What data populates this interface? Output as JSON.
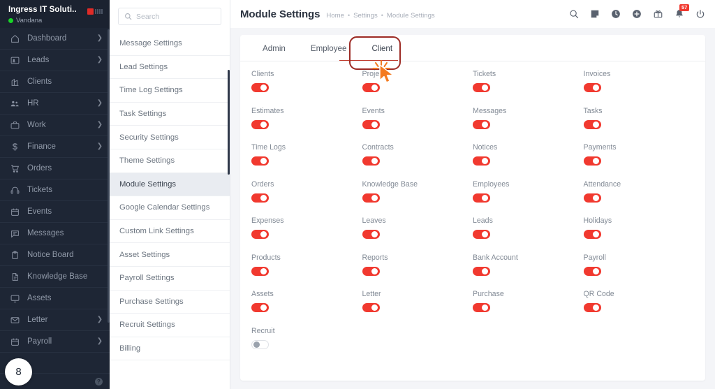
{
  "sidebar": {
    "org_name": "Ingress IT Soluti...",
    "user_name": "Vandana",
    "status_dot_color": "#18d427",
    "logo_color": "#e02b27",
    "items": [
      {
        "label": "Dashboard",
        "icon": "home-icon",
        "has_chevron": true
      },
      {
        "label": "Leads",
        "icon": "leads-icon",
        "has_chevron": true
      },
      {
        "label": "Clients",
        "icon": "clients-icon",
        "has_chevron": false
      },
      {
        "label": "HR",
        "icon": "hr-icon",
        "has_chevron": true
      },
      {
        "label": "Work",
        "icon": "work-icon",
        "has_chevron": true
      },
      {
        "label": "Finance",
        "icon": "finance-icon",
        "has_chevron": true
      },
      {
        "label": "Orders",
        "icon": "orders-icon",
        "has_chevron": false
      },
      {
        "label": "Tickets",
        "icon": "tickets-icon",
        "has_chevron": false
      },
      {
        "label": "Events",
        "icon": "events-icon",
        "has_chevron": false
      },
      {
        "label": "Messages",
        "icon": "messages-icon",
        "has_chevron": false
      },
      {
        "label": "Notice Board",
        "icon": "notice-board-icon",
        "has_chevron": false
      },
      {
        "label": "Knowledge Base",
        "icon": "knowledge-base-icon",
        "has_chevron": false
      },
      {
        "label": "Assets",
        "icon": "assets-icon",
        "has_chevron": false
      },
      {
        "label": "Letter",
        "icon": "letter-icon",
        "has_chevron": true
      },
      {
        "label": "Payroll",
        "icon": "payroll-icon",
        "has_chevron": true
      }
    ],
    "step_badge": "8",
    "help_glyph": "?"
  },
  "settings_panel": {
    "search_placeholder": "Search",
    "search_value": "",
    "active_item": "Module Settings",
    "items": [
      "Message Settings",
      "Lead Settings",
      "Time Log Settings",
      "Task Settings",
      "Security Settings",
      "Theme Settings",
      "Module Settings",
      "Google Calendar Settings",
      "Custom Link Settings",
      "Asset Settings",
      "Payroll Settings",
      "Purchase Settings",
      "Recruit Settings",
      "Billing"
    ]
  },
  "header": {
    "title": "Module Settings",
    "breadcrumb": [
      "Home",
      "Settings",
      "Module Settings"
    ],
    "separator": "•",
    "icons": [
      {
        "name": "search-icon"
      },
      {
        "name": "note-icon"
      },
      {
        "name": "clock-icon"
      },
      {
        "name": "plus-circle-icon"
      },
      {
        "name": "gift-icon"
      },
      {
        "name": "bell-icon",
        "badge": "57"
      },
      {
        "name": "power-icon"
      }
    ],
    "badge_color": "#f1392f"
  },
  "main": {
    "tabs": [
      {
        "label": "Admin",
        "active": false
      },
      {
        "label": "Employee",
        "active": false
      },
      {
        "label": "Client",
        "active": true
      }
    ],
    "toggle_on_color": "#f1392f",
    "toggle_off_color": "#9aa2ad",
    "modules": [
      {
        "label": "Clients",
        "enabled": true
      },
      {
        "label": "Projects",
        "enabled": true
      },
      {
        "label": "Tickets",
        "enabled": true
      },
      {
        "label": "Invoices",
        "enabled": true
      },
      {
        "label": "Estimates",
        "enabled": true
      },
      {
        "label": "Events",
        "enabled": true
      },
      {
        "label": "Messages",
        "enabled": true
      },
      {
        "label": "Tasks",
        "enabled": true
      },
      {
        "label": "Time Logs",
        "enabled": true
      },
      {
        "label": "Contracts",
        "enabled": true
      },
      {
        "label": "Notices",
        "enabled": true
      },
      {
        "label": "Payments",
        "enabled": true
      },
      {
        "label": "Orders",
        "enabled": true
      },
      {
        "label": "Knowledge Base",
        "enabled": true
      },
      {
        "label": "Employees",
        "enabled": true
      },
      {
        "label": "Attendance",
        "enabled": true
      },
      {
        "label": "Expenses",
        "enabled": true
      },
      {
        "label": "Leaves",
        "enabled": true
      },
      {
        "label": "Leads",
        "enabled": true
      },
      {
        "label": "Holidays",
        "enabled": true
      },
      {
        "label": "Products",
        "enabled": true
      },
      {
        "label": "Reports",
        "enabled": true
      },
      {
        "label": "Bank Account",
        "enabled": true
      },
      {
        "label": "Payroll",
        "enabled": true
      },
      {
        "label": "Assets",
        "enabled": true
      },
      {
        "label": "Letter",
        "enabled": true
      },
      {
        "label": "Purchase",
        "enabled": true
      },
      {
        "label": "QR Code",
        "enabled": true
      },
      {
        "label": "Recruit",
        "enabled": false
      }
    ]
  },
  "annotation": {
    "target": "Client",
    "box_color": "#9c2a24",
    "cursor_color": "#f47b20"
  }
}
